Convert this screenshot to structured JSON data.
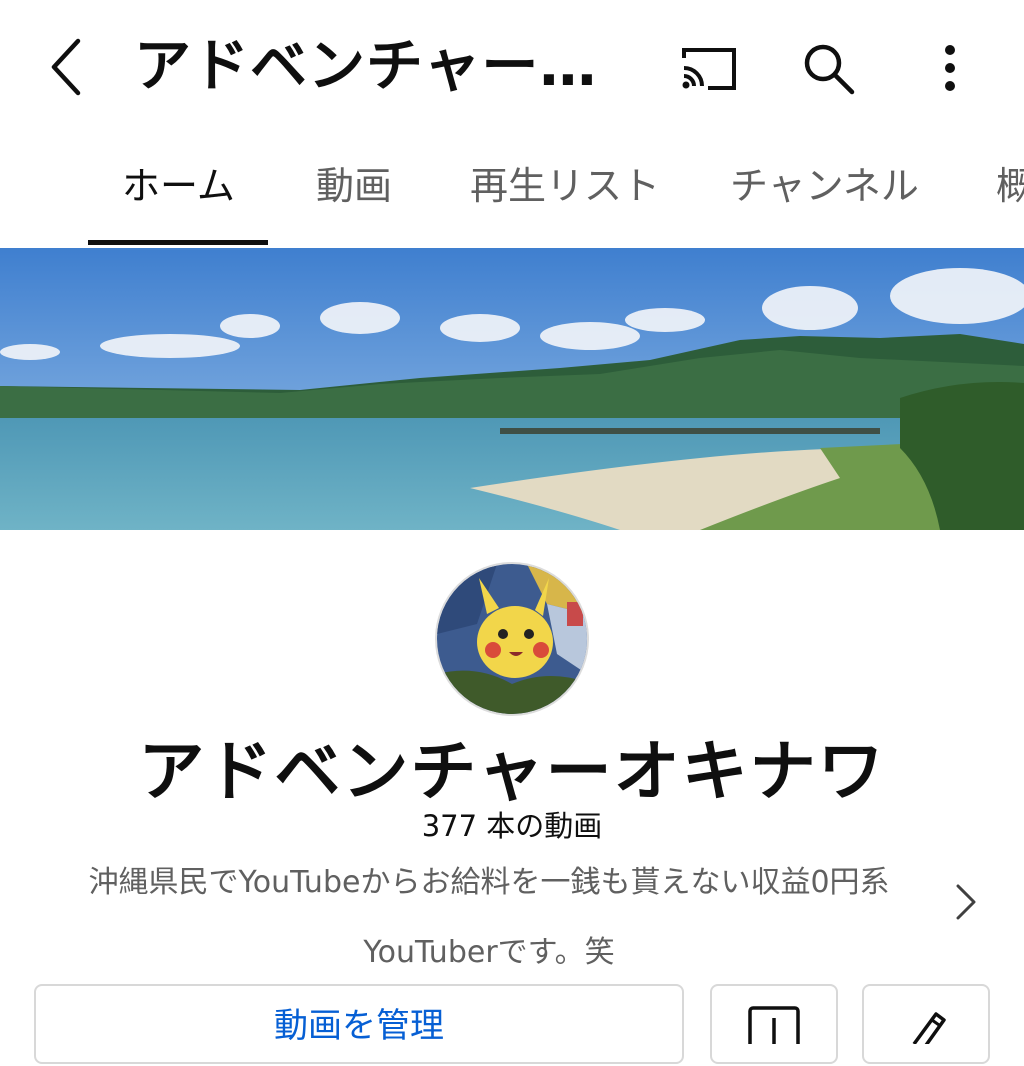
{
  "header": {
    "title": "アドベンチャー…",
    "icons": [
      "back-arrow-icon",
      "cast-icon",
      "search-icon",
      "more-vert-icon"
    ]
  },
  "tabs": [
    {
      "label": "ホーム",
      "active": true
    },
    {
      "label": "動画",
      "active": false
    },
    {
      "label": "再生リスト",
      "active": false
    },
    {
      "label": "チャンネル",
      "active": false
    },
    {
      "label": "概",
      "active": false
    }
  ],
  "channel": {
    "name": "アドベンチャーオキナワ",
    "video_count": "377 本の動画",
    "description_line1": "沖縄県民でYouTubeからお給料を一銭も貰えない収益0円系",
    "description_line2": "YouTuberです。笑"
  },
  "actions": {
    "manage_label": "動画を管理",
    "icons": [
      "chevron-right-icon",
      "analytics-icon",
      "pencil-icon"
    ]
  },
  "colors": {
    "text_primary": "#0f0f0f",
    "text_secondary": "#606060",
    "link_blue": "#065fd4",
    "divider": "#d8d8d8"
  }
}
